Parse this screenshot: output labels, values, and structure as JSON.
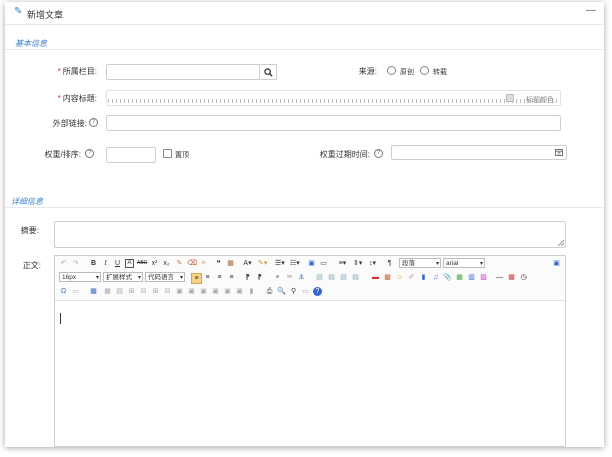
{
  "window": {
    "title": "新增文章",
    "minimize": "—"
  },
  "sections": {
    "basic": "基本信息",
    "detail": "详细信息"
  },
  "form": {
    "category_label": "所属栏目:",
    "title_label": "内容标题:",
    "title_color_label": "标题颜色",
    "external_link_label": "外部链接:",
    "weight_label": "权重/排序:",
    "pin_label": "置顶",
    "source_label": "来源:",
    "source_options": [
      "原创",
      "转载"
    ],
    "expire_label": "权重过期时间:",
    "summary_label": "摘要:",
    "body_label": "正文:"
  },
  "editor": {
    "paragraph_select": "段落",
    "font_select": "arial",
    "size_select": "16px",
    "ext_style_select": "扩展样式",
    "code_lang_select": "代码语言"
  },
  "icons": {
    "title": "edit-icon",
    "search": "search-icon",
    "help": "question-circle-icon",
    "calendar": "calendar-icon"
  },
  "colors": {
    "accent": "#3a7fd5",
    "required": "#e22233",
    "border": "#cfcfcf"
  }
}
